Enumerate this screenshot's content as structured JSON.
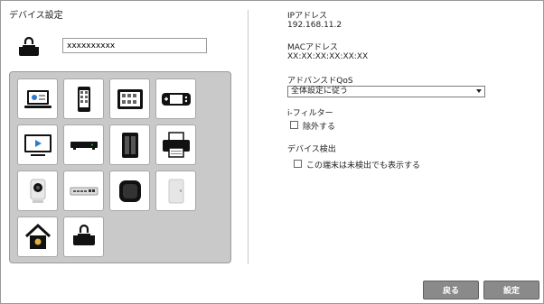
{
  "device_settings": {
    "title": "デバイス設定",
    "icon": "device-lock-icon",
    "device_name": "xxxxxxxxxx"
  },
  "icons": [
    {
      "name": "laptop-icon"
    },
    {
      "name": "smartphone-icon"
    },
    {
      "name": "tablet-icon"
    },
    {
      "name": "game-console-icon"
    },
    {
      "name": "tv-icon"
    },
    {
      "name": "set-top-box-icon"
    },
    {
      "name": "nas-icon"
    },
    {
      "name": "printer-icon"
    },
    {
      "name": "webcam-icon"
    },
    {
      "name": "network-switch-icon"
    },
    {
      "name": "smart-speaker-icon"
    },
    {
      "name": "generic-device-icon"
    },
    {
      "name": "smart-home-icon"
    },
    {
      "name": "device-lock-icon"
    }
  ],
  "network": {
    "ip_label": "IPアドレス",
    "ip_value": "192.168.11.2",
    "mac_label": "MACアドレス",
    "mac_value": "XX:XX:XX:XX:XX:XX",
    "qos_label": "アドバンスドQoS",
    "qos_value": "全体設定に従う",
    "filter_label": "i-フィルター",
    "filter_checkbox_label": "除外する",
    "filter_checked": false,
    "detect_label": "デバイス検出",
    "detect_checkbox_label": "この端末は未検出でも表示する",
    "detect_checked": false
  },
  "buttons": {
    "back_label": "戻る",
    "save_label": "設定"
  }
}
